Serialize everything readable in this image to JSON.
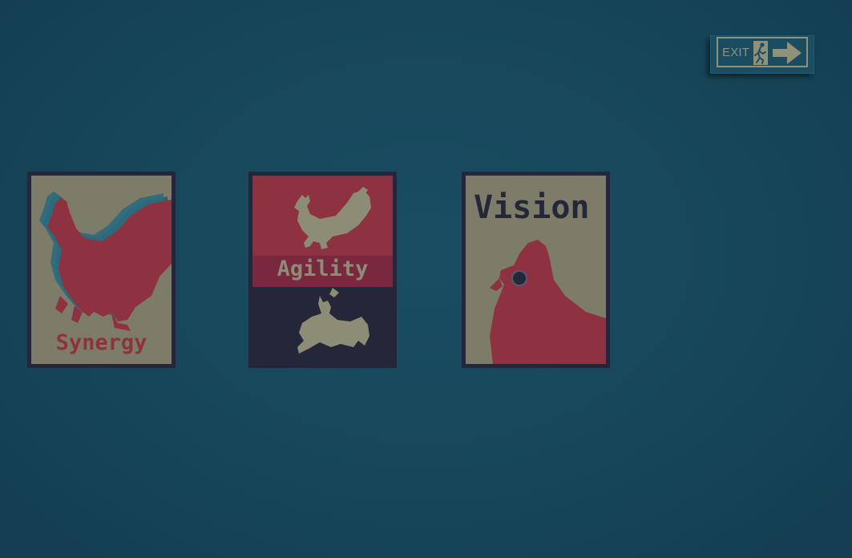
{
  "exit_button": {
    "label": "EXIT"
  },
  "cards": [
    {
      "id": "synergy",
      "label": "Synergy"
    },
    {
      "id": "agility",
      "label": "Agility"
    },
    {
      "id": "vision",
      "label": "Vision"
    }
  ],
  "colors": {
    "background": "#174659",
    "card_red": "#8e3242",
    "card_tan": "#7d7c68",
    "card_dark": "#24263a",
    "exit_tan": "#8f9277"
  }
}
